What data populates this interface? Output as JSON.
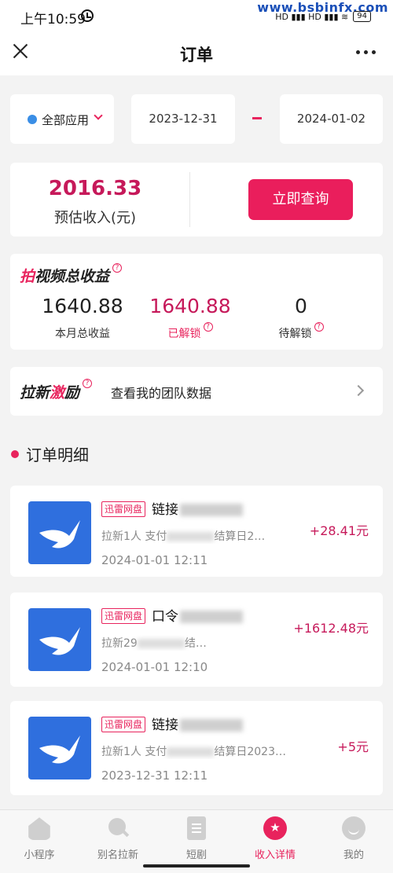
{
  "status_bar": {
    "time": "上午10:59",
    "watermark": "www.bsbinfx.com",
    "network": "HD ▮▮▮ HD ▮▮▮ ≋",
    "battery": "94"
  },
  "navbar": {
    "title": "订单"
  },
  "filters": {
    "app": "全部应用",
    "start_date": "2023-12-31",
    "end_date": "2024-01-02"
  },
  "summary": {
    "amount": "2016.33",
    "label": "预估收入(元)",
    "query_button": "立即查询"
  },
  "earnings": {
    "title_red": "拍",
    "title_rest": "视频总收益",
    "help": "?",
    "stats": [
      {
        "value": "1640.88",
        "label": "本月总收益"
      },
      {
        "value": "1640.88",
        "label": "已解锁"
      },
      {
        "value": "0",
        "label": "待解锁"
      }
    ]
  },
  "team": {
    "title_a": "拉新",
    "title_b": "激",
    "title_c": "励",
    "help": "?",
    "link": "查看我的团队数据"
  },
  "orders_section": {
    "title": "订单明细"
  },
  "orders": [
    {
      "tag": "迅雷网盘",
      "name": "链接",
      "desc": "拉新1人 支付",
      "desc_tail": "结算日2…",
      "time": "2024-01-01 12:11",
      "amount": "+28.41元"
    },
    {
      "tag": "迅雷网盘",
      "name": "口令",
      "desc": "拉新29",
      "desc_tail": "结…",
      "time": "2024-01-01 12:10",
      "amount": "+1612.48元"
    },
    {
      "tag": "迅雷网盘",
      "name": "链接",
      "desc": "拉新1人 支付",
      "desc_tail": "结算日2023…",
      "time": "2023-12-31 12:11",
      "amount": "+5元"
    }
  ],
  "tabbar": [
    {
      "label": "小程序",
      "icon": "home-icon"
    },
    {
      "label": "别名拉新",
      "icon": "search-icon"
    },
    {
      "label": "短剧",
      "icon": "document-icon"
    },
    {
      "label": "收入详情",
      "icon": "income-badge-icon",
      "active": true
    },
    {
      "label": "我的",
      "icon": "profile-icon"
    }
  ],
  "colors": {
    "accent": "#e8235d",
    "amount": "#c6195a",
    "app_icon": "#2f6fde"
  }
}
